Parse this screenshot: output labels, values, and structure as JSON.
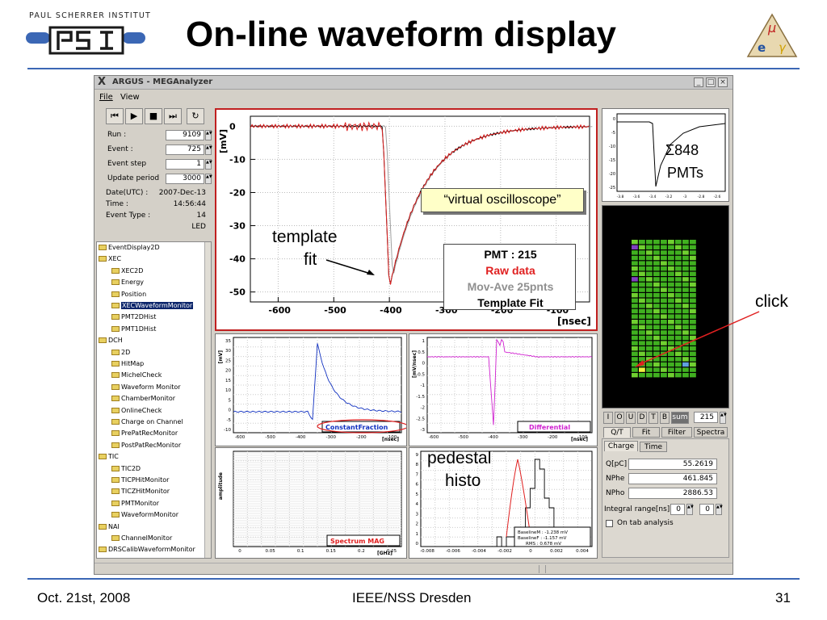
{
  "slide": {
    "title": "On-line waveform display",
    "institute": "PAUL SCHERRER INSTITUT",
    "psi_logo_text": "PSI",
    "meg_logo": "MEG",
    "footer_left": "Oct. 21st, 2008",
    "footer_center": "IEEE/NSS Dresden",
    "footer_right": "31",
    "accent_color": "#3b67b5"
  },
  "window": {
    "title": "ARGUS - MEGAnalyzer",
    "menu": [
      "File",
      "View"
    ],
    "buttons": [
      "minimize",
      "maximize",
      "close"
    ]
  },
  "controls": {
    "playback": [
      "skip-back",
      "play",
      "stop",
      "skip-forward",
      "refresh"
    ],
    "fields": [
      {
        "label": "Run :",
        "value": "9109"
      },
      {
        "label": "Event :",
        "value": "725"
      },
      {
        "label": "Event step",
        "value": "1"
      },
      {
        "label": "Update period",
        "value": "3000"
      }
    ],
    "info": [
      {
        "label": "Date(UTC) :",
        "value": "2007-Dec-13"
      },
      {
        "label": "Time :",
        "value": "14:56:44"
      },
      {
        "label": "Event Type :",
        "value": "14"
      },
      {
        "label": "",
        "value": "LED"
      }
    ]
  },
  "tree": [
    {
      "label": "EventDisplay2D",
      "level": 0
    },
    {
      "label": "XEC",
      "level": 0
    },
    {
      "label": "XEC2D",
      "level": 1
    },
    {
      "label": "Energy",
      "level": 1
    },
    {
      "label": "Position",
      "level": 1
    },
    {
      "label": "XECWaveformMonitor",
      "level": 1,
      "selected": true
    },
    {
      "label": "PMT2DHist",
      "level": 1
    },
    {
      "label": "PMT1DHist",
      "level": 1
    },
    {
      "label": "DCH",
      "level": 0
    },
    {
      "label": "2D",
      "level": 1
    },
    {
      "label": "HitMap",
      "level": 1
    },
    {
      "label": "MichelCheck",
      "level": 1
    },
    {
      "label": "Waveform Monitor",
      "level": 1
    },
    {
      "label": "ChamberMonitor",
      "level": 1
    },
    {
      "label": "OnlineCheck",
      "level": 1
    },
    {
      "label": "Charge on Channel",
      "level": 1
    },
    {
      "label": "PrePatRecMonitor",
      "level": 1
    },
    {
      "label": "PostPatRecMonitor",
      "level": 1
    },
    {
      "label": "TIC",
      "level": 0
    },
    {
      "label": "TIC2D",
      "level": 1
    },
    {
      "label": "TICPHitMonitor",
      "level": 1
    },
    {
      "label": "TICZHitMonitor",
      "level": 1
    },
    {
      "label": "PMTMonitor",
      "level": 1
    },
    {
      "label": "WaveformMonitor",
      "level": 1
    },
    {
      "label": "NAI",
      "level": 0
    },
    {
      "label": "ChannelMonitor",
      "level": 1
    },
    {
      "label": "DRSCalibWaveformMonitor",
      "level": 0
    }
  ],
  "main_plot": {
    "ylabel": "[mV]",
    "xlabel": "[nsec]",
    "xticks": [
      "-600",
      "-500",
      "-400",
      "-300",
      "-200",
      "-100"
    ],
    "yticks": [
      "0",
      "-10",
      "-20",
      "-30",
      "-40",
      "-50"
    ],
    "legend": {
      "pmt": "PMT : 215",
      "raw": "Raw data",
      "mov": "Mov-Ave 25pnts",
      "fit": "Template Fit"
    },
    "raw_color": "#e02020",
    "mov_color": "#a0a0a0",
    "fit_color": "#000000"
  },
  "small_plots": {
    "cf": {
      "ylabel": "[mV]",
      "xlabel": "[nsec]",
      "label": "ConstantFraction",
      "yticks": [
        "35",
        "30",
        "25",
        "20",
        "15",
        "10",
        "5",
        "0",
        "-5",
        "-10"
      ],
      "xticks": [
        "-600",
        "-500",
        "-400",
        "-300",
        "-200",
        "-100"
      ]
    },
    "diff": {
      "ylabel": "[mV/nsec]",
      "xlabel": "[nsec]",
      "label": "Differential",
      "yticks": [
        "1",
        "0.5",
        "0",
        "-0.5",
        "-1",
        "-1.5",
        "-2",
        "-2.5",
        "-3"
      ],
      "xticks": [
        "-600",
        "-500",
        "-400",
        "-300",
        "-200",
        "-100"
      ]
    },
    "spectrum": {
      "ylabel": "amplitude",
      "xlabel": "[GHz]",
      "label": "Spectrum MAG",
      "xticks": [
        "0",
        "0.05",
        "0.1",
        "0.15",
        "0.2",
        "0.25"
      ]
    },
    "pedestal": {
      "label1": "BaselineM : -1.238 mV",
      "label2": "BaselineF : -1.157 mV",
      "label3": "RMS : 0.678 mV",
      "xticks": [
        "-0.008",
        "-0.006",
        "-0.004",
        "-0.002",
        "0",
        "0.002",
        "0.004"
      ],
      "yticks": [
        "9",
        "8",
        "7",
        "6",
        "5",
        "4",
        "3",
        "2",
        "1",
        "0"
      ]
    }
  },
  "pmt_sum": {
    "label": "Σ848\nPMTs",
    "sigma": "Σ848",
    "pmts": "PMTs"
  },
  "pmt_selector": {
    "buttons": [
      "I",
      "O",
      "U",
      "D",
      "T",
      "B",
      "sum"
    ],
    "value": "215",
    "tabs": [
      "Q/T",
      "Fit",
      "Filter",
      "Spectra"
    ],
    "subtabs": [
      "Charge",
      "Time"
    ],
    "fields": [
      {
        "label": "Q[pC]",
        "value": "55.2619"
      },
      {
        "label": "NPhe",
        "value": "461.845"
      },
      {
        "label": "NPho",
        "value": "2886.53"
      }
    ],
    "integral_label": "Integral range[ns]",
    "integral_from": "0",
    "integral_to": "0",
    "on_tab_label": "On tab analysis"
  },
  "annotations": {
    "template_fit_1": "template",
    "template_fit_2": "fit",
    "virtual_oscilloscope": "“virtual oscilloscope”",
    "click": "click",
    "pedestal_1": "pedestal",
    "pedestal_2": "histo"
  }
}
